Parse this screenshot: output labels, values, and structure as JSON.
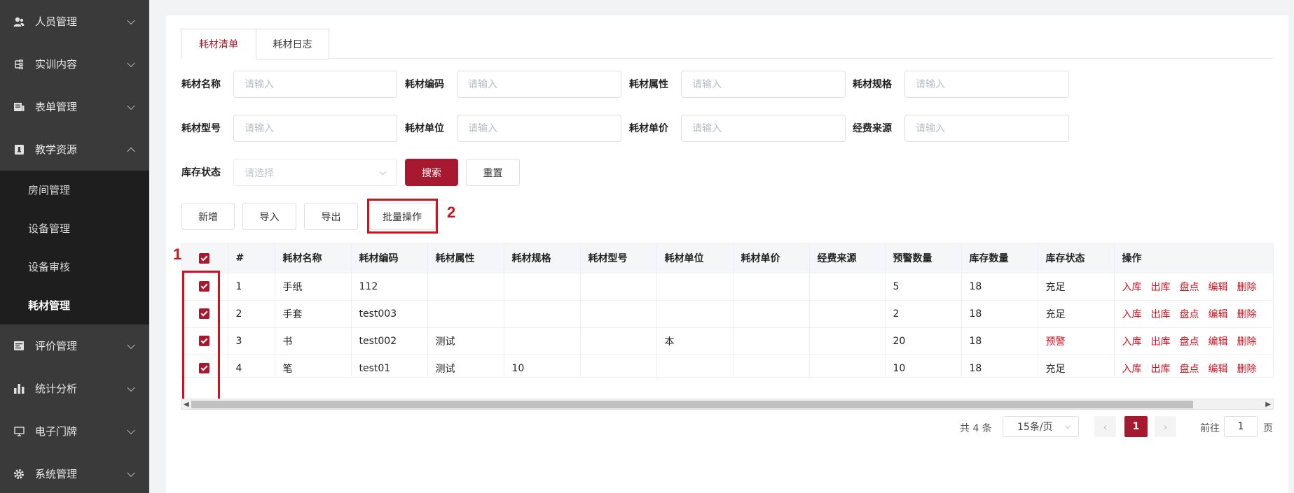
{
  "sidebar": {
    "items": [
      {
        "label": "人员管理",
        "icon": "user-icon"
      },
      {
        "label": "实训内容",
        "icon": "tree-icon"
      },
      {
        "label": "表单管理",
        "icon": "form-icon"
      },
      {
        "label": "教学资源",
        "icon": "book-icon"
      },
      {
        "label": "评价管理",
        "icon": "rating-icon"
      },
      {
        "label": "统计分析",
        "icon": "chart-icon"
      },
      {
        "label": "电子门牌",
        "icon": "monitor-icon"
      },
      {
        "label": "系统管理",
        "icon": "gear-icon"
      }
    ],
    "submenu": [
      "房间管理",
      "设备管理",
      "设备审核",
      "耗材管理"
    ],
    "active_sub": "耗材管理"
  },
  "tabs": [
    "耗材清单",
    "耗材日志"
  ],
  "filters": {
    "labels": [
      "耗材名称",
      "耗材编码",
      "耗材属性",
      "耗材规格",
      "耗材型号",
      "耗材单位",
      "耗材单价",
      "经费来源",
      "库存状态"
    ],
    "input_placeholder": "请输入",
    "select_placeholder": "请选择",
    "search_label": "搜索",
    "reset_label": "重置"
  },
  "toolbar": {
    "add": "新增",
    "import": "导入",
    "export": "导出",
    "batch": "批量操作"
  },
  "annotations": [
    "1",
    "2"
  ],
  "table": {
    "columns": [
      "#",
      "耗材名称",
      "耗材编码",
      "耗材属性",
      "耗材规格",
      "耗材型号",
      "耗材单位",
      "耗材单价",
      "经费来源",
      "预警数量",
      "库存数量",
      "库存状态",
      "操作"
    ],
    "rows": [
      [
        "1",
        "手纸",
        "112",
        "",
        "",
        "",
        "",
        "",
        "",
        "5",
        "18",
        "充足"
      ],
      [
        "2",
        "手套",
        "test003",
        "",
        "",
        "",
        "",
        "",
        "",
        "2",
        "18",
        "充足"
      ],
      [
        "3",
        "书",
        "test002",
        "测试",
        "",
        "",
        "本",
        "",
        "",
        "20",
        "18",
        "预警"
      ],
      [
        "4",
        "笔",
        "test01",
        "测试",
        "10",
        "",
        "",
        "",
        "",
        "10",
        "18",
        "充足"
      ]
    ],
    "actions": [
      "入库",
      "出库",
      "盘点",
      "编辑",
      "删除"
    ]
  },
  "pagination": {
    "total": "共 4 条",
    "page_size": "15条/页",
    "current": "1",
    "goto_prefix": "前往",
    "goto_value": "1",
    "goto_suffix": "页"
  },
  "colors": {
    "accent": "#a6192e",
    "warning": "#d0121f",
    "sidebar": "#3a3a3a"
  }
}
